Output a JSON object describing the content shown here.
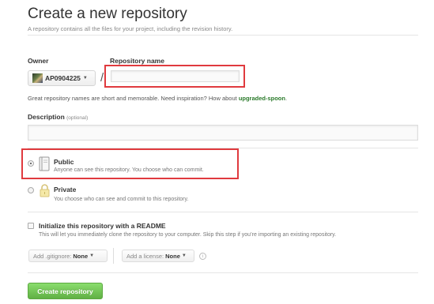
{
  "header": {
    "title": "Create a new repository",
    "subtitle": "A repository contains all the files for your project, including the revision history."
  },
  "owner": {
    "label": "Owner",
    "value": "AP0904225",
    "avatar_icon": "owner-avatar",
    "separator": "/"
  },
  "repository_name": {
    "label": "Repository name",
    "value": "",
    "placeholder": ""
  },
  "name_hint": {
    "text": "Great repository names are short and memorable. Need inspiration? How about ",
    "suggestion": "upgraded-spoon",
    "suffix": "."
  },
  "description": {
    "label": "Description",
    "optional": "(optional)",
    "value": "",
    "placeholder": ""
  },
  "visibility": {
    "selected": "public",
    "public": {
      "title": "Public",
      "desc": "Anyone can see this repository. You choose who can commit.",
      "icon": "book-icon"
    },
    "private": {
      "title": "Private",
      "desc": "You choose who can see and commit to this repository.",
      "icon": "lock-icon"
    }
  },
  "readme": {
    "checked": false,
    "title": "Initialize this repository with a README",
    "desc": "This will let you immediately clone the repository to your computer. Skip this step if you’re importing an existing repository."
  },
  "gitignore": {
    "label": "Add .gitignore:",
    "value": "None"
  },
  "license": {
    "label": "Add a license:",
    "value": "None"
  },
  "info_icon": "info-icon",
  "submit": {
    "label": "Create repository",
    "color": "#60b044"
  },
  "highlight_color": "#e03a3e"
}
